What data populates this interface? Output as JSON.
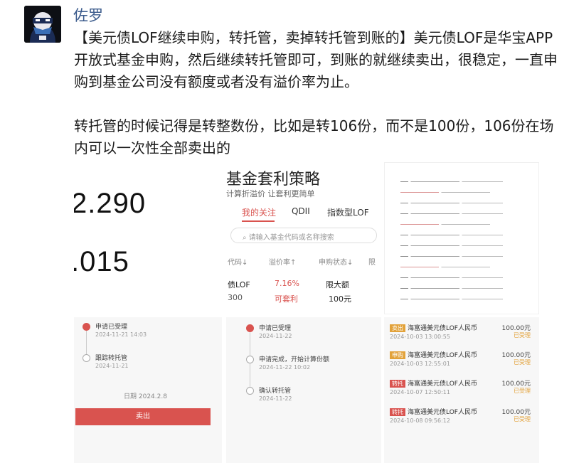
{
  "user": {
    "name": "佐罗",
    "avatar_icon": "masked-ninja-avatar"
  },
  "post": {
    "paragraphs": [
      "【美元债LOF继续申购，转托管，卖掉转托管到账的】美元债LOF是华宝APP开放式基金申购，然后继续转托管即可，到账的就继续卖出，很稳定，一直申购到基金公司没有额度或者没有溢价率为止。",
      "转托管的时候记得是转整数份，比如是转106份，而不是100份，106份在场内可以一次性全部卖出的"
    ]
  },
  "tiles": {
    "t1": {
      "num1": "2.290",
      "num2": ".015"
    },
    "t2": {
      "title": "基金套利策略",
      "subtitle": "计算折溢价 让套利更简单",
      "tabs": [
        "我的关注",
        "QDII",
        "指数型LOF"
      ],
      "search_placeholder": "请输入基金代码或名称搜索",
      "columns": [
        "代码↓",
        "溢价率↑",
        "申购状态↓",
        "限"
      ],
      "row": {
        "name": "债LOF",
        "code": "300",
        "premium": "7.16%",
        "hint": "可套利",
        "status": "限大额",
        "limit": "100元"
      }
    },
    "t4": {
      "steps": [
        "申请已受理",
        "跟踪转托管",
        ""
      ],
      "dates": [
        "2024-11-21 14:03",
        "2024-11-21",
        ""
      ],
      "mid_text": "日期 2024.2.8",
      "button": "卖出"
    },
    "t5": {
      "steps": [
        "申请已受理",
        "申请完成，开始计算份额",
        "确认转托管"
      ],
      "dates": [
        "2024-11-22",
        "2024-11-22 10:02",
        "2024-11-22"
      ]
    },
    "t6": {
      "records": [
        {
          "tag": "卖出",
          "desc": "海富通美元债LOF人民币",
          "date": "2024-10-03 13:00:55",
          "amount": "100.00元",
          "status": "已受理",
          "tag_color": "#e2a23a"
        },
        {
          "tag": "申购",
          "desc": "海富通美元债LOF人民币",
          "date": "2024-10-03 12:55:01",
          "amount": "100.00元",
          "status": "已受理",
          "tag_color": "#e2a23a"
        },
        {
          "tag": "转托",
          "desc": "海富通美元债LOF人民币",
          "date": "2024-10-07 12:50:11",
          "amount": "100.00元",
          "status": "已受理",
          "tag_color": "#d9534f"
        },
        {
          "tag": "转托",
          "desc": "海富通美元债LOF人民币",
          "date": "2024-10-08 09:56:12",
          "amount": "100.00元",
          "status": "已受理",
          "tag_color": "#d9534f"
        }
      ]
    }
  }
}
